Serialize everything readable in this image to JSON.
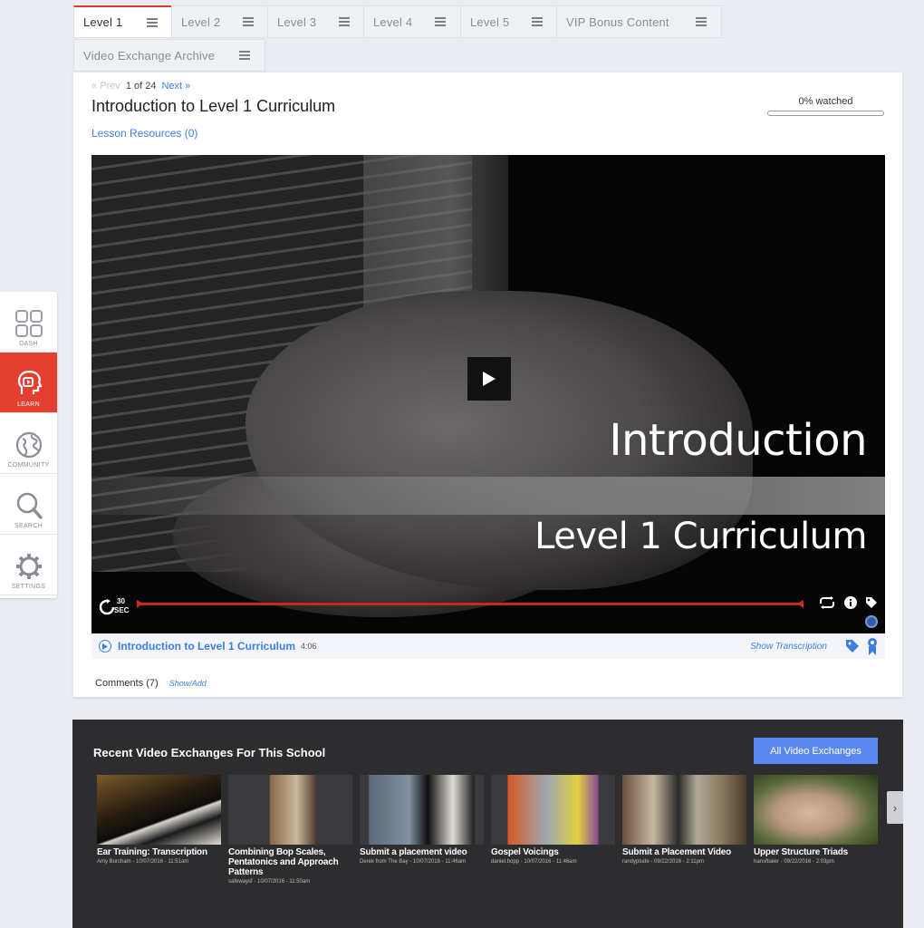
{
  "tabs": [
    {
      "label": "Level 1",
      "active": true
    },
    {
      "label": "Level 2"
    },
    {
      "label": "Level 3"
    },
    {
      "label": "Level 4"
    },
    {
      "label": "Level 5"
    },
    {
      "label": "VIP Bonus Content"
    },
    {
      "label": "Video Exchange Archive"
    }
  ],
  "lesson": {
    "prev": "Prev",
    "position": "1 of 24",
    "next": "Next",
    "title": "Introduction to Level 1 Curriculum",
    "resources": "Lesson Resources (0)",
    "watched_label": "0% watched",
    "watched_pct": 0
  },
  "video": {
    "overlay_line1": "Introduction",
    "overlay_line2": "Level 1 Curriculum",
    "skip_num": "30",
    "skip_unit": "SEC",
    "caption_title": "Introduction to Level 1 Curriculum",
    "duration": "4:06",
    "show_transcription": "Show Transcription"
  },
  "comments": {
    "label": "Comments (7)",
    "show_add": "Show/Add"
  },
  "dock": [
    {
      "label": "DASH",
      "icon": "dashboard-grid-icon"
    },
    {
      "label": "LEARN",
      "icon": "learn-head-icon",
      "active": true
    },
    {
      "label": "COMMUNITY",
      "icon": "globe-icon"
    },
    {
      "label": "SEARCH",
      "icon": "search-icon"
    },
    {
      "label": "SETTINGS",
      "icon": "gear-icon"
    }
  ],
  "recent": {
    "heading": "Recent Video Exchanges For This School",
    "all_button": "All Video Exchanges",
    "items": [
      {
        "title": "Ear Training: Transcription",
        "meta": "Amy Burcham - 10/07/2016 - 11:51am"
      },
      {
        "title": "Combining Bop Scales, Pentatonics and Approach Patterns",
        "meta": "safewaysf - 10/07/2016 - 11:50am"
      },
      {
        "title": "Submit a placement video",
        "meta": "Derek from The Bay - 10/07/2016 - 11:46am"
      },
      {
        "title": "Gospel Voicings",
        "meta": "daniel.bopp - 10/07/2016 - 11:46am"
      },
      {
        "title": "Submit a Placement Video",
        "meta": "randyplude - 09/22/2016 - 2:11pm"
      },
      {
        "title": "Upper Structure Triads",
        "meta": "hansfbaier - 09/22/2016 - 2:03pm"
      }
    ],
    "next_arrow": "›"
  },
  "colors": {
    "accent_blue": "#3d7ee6",
    "brand_red": "#e5402f",
    "button_blue": "#5b88f0"
  }
}
